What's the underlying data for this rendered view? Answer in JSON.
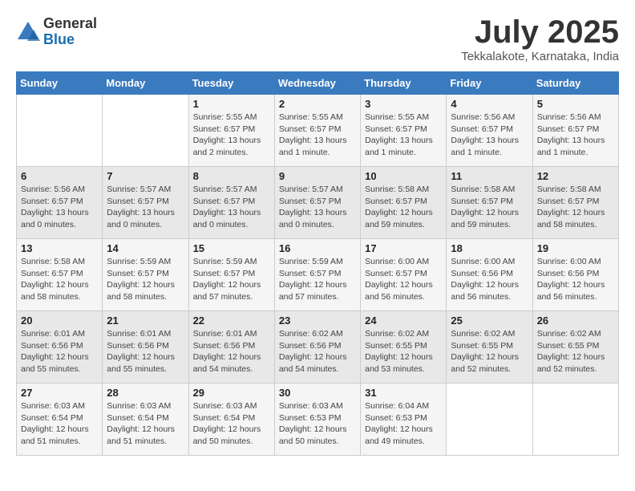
{
  "logo": {
    "line1": "General",
    "line2": "Blue"
  },
  "title": "July 2025",
  "location": "Tekkalakote, Karnataka, India",
  "days_of_week": [
    "Sunday",
    "Monday",
    "Tuesday",
    "Wednesday",
    "Thursday",
    "Friday",
    "Saturday"
  ],
  "weeks": [
    [
      {
        "day": "",
        "info": ""
      },
      {
        "day": "",
        "info": ""
      },
      {
        "day": "1",
        "info": "Sunrise: 5:55 AM\nSunset: 6:57 PM\nDaylight: 13 hours and 2 minutes."
      },
      {
        "day": "2",
        "info": "Sunrise: 5:55 AM\nSunset: 6:57 PM\nDaylight: 13 hours and 1 minute."
      },
      {
        "day": "3",
        "info": "Sunrise: 5:55 AM\nSunset: 6:57 PM\nDaylight: 13 hours and 1 minute."
      },
      {
        "day": "4",
        "info": "Sunrise: 5:56 AM\nSunset: 6:57 PM\nDaylight: 13 hours and 1 minute."
      },
      {
        "day": "5",
        "info": "Sunrise: 5:56 AM\nSunset: 6:57 PM\nDaylight: 13 hours and 1 minute."
      }
    ],
    [
      {
        "day": "6",
        "info": "Sunrise: 5:56 AM\nSunset: 6:57 PM\nDaylight: 13 hours and 0 minutes."
      },
      {
        "day": "7",
        "info": "Sunrise: 5:57 AM\nSunset: 6:57 PM\nDaylight: 13 hours and 0 minutes."
      },
      {
        "day": "8",
        "info": "Sunrise: 5:57 AM\nSunset: 6:57 PM\nDaylight: 13 hours and 0 minutes."
      },
      {
        "day": "9",
        "info": "Sunrise: 5:57 AM\nSunset: 6:57 PM\nDaylight: 13 hours and 0 minutes."
      },
      {
        "day": "10",
        "info": "Sunrise: 5:58 AM\nSunset: 6:57 PM\nDaylight: 12 hours and 59 minutes."
      },
      {
        "day": "11",
        "info": "Sunrise: 5:58 AM\nSunset: 6:57 PM\nDaylight: 12 hours and 59 minutes."
      },
      {
        "day": "12",
        "info": "Sunrise: 5:58 AM\nSunset: 6:57 PM\nDaylight: 12 hours and 58 minutes."
      }
    ],
    [
      {
        "day": "13",
        "info": "Sunrise: 5:58 AM\nSunset: 6:57 PM\nDaylight: 12 hours and 58 minutes."
      },
      {
        "day": "14",
        "info": "Sunrise: 5:59 AM\nSunset: 6:57 PM\nDaylight: 12 hours and 58 minutes."
      },
      {
        "day": "15",
        "info": "Sunrise: 5:59 AM\nSunset: 6:57 PM\nDaylight: 12 hours and 57 minutes."
      },
      {
        "day": "16",
        "info": "Sunrise: 5:59 AM\nSunset: 6:57 PM\nDaylight: 12 hours and 57 minutes."
      },
      {
        "day": "17",
        "info": "Sunrise: 6:00 AM\nSunset: 6:57 PM\nDaylight: 12 hours and 56 minutes."
      },
      {
        "day": "18",
        "info": "Sunrise: 6:00 AM\nSunset: 6:56 PM\nDaylight: 12 hours and 56 minutes."
      },
      {
        "day": "19",
        "info": "Sunrise: 6:00 AM\nSunset: 6:56 PM\nDaylight: 12 hours and 56 minutes."
      }
    ],
    [
      {
        "day": "20",
        "info": "Sunrise: 6:01 AM\nSunset: 6:56 PM\nDaylight: 12 hours and 55 minutes."
      },
      {
        "day": "21",
        "info": "Sunrise: 6:01 AM\nSunset: 6:56 PM\nDaylight: 12 hours and 55 minutes."
      },
      {
        "day": "22",
        "info": "Sunrise: 6:01 AM\nSunset: 6:56 PM\nDaylight: 12 hours and 54 minutes."
      },
      {
        "day": "23",
        "info": "Sunrise: 6:02 AM\nSunset: 6:56 PM\nDaylight: 12 hours and 54 minutes."
      },
      {
        "day": "24",
        "info": "Sunrise: 6:02 AM\nSunset: 6:55 PM\nDaylight: 12 hours and 53 minutes."
      },
      {
        "day": "25",
        "info": "Sunrise: 6:02 AM\nSunset: 6:55 PM\nDaylight: 12 hours and 52 minutes."
      },
      {
        "day": "26",
        "info": "Sunrise: 6:02 AM\nSunset: 6:55 PM\nDaylight: 12 hours and 52 minutes."
      }
    ],
    [
      {
        "day": "27",
        "info": "Sunrise: 6:03 AM\nSunset: 6:54 PM\nDaylight: 12 hours and 51 minutes."
      },
      {
        "day": "28",
        "info": "Sunrise: 6:03 AM\nSunset: 6:54 PM\nDaylight: 12 hours and 51 minutes."
      },
      {
        "day": "29",
        "info": "Sunrise: 6:03 AM\nSunset: 6:54 PM\nDaylight: 12 hours and 50 minutes."
      },
      {
        "day": "30",
        "info": "Sunrise: 6:03 AM\nSunset: 6:53 PM\nDaylight: 12 hours and 50 minutes."
      },
      {
        "day": "31",
        "info": "Sunrise: 6:04 AM\nSunset: 6:53 PM\nDaylight: 12 hours and 49 minutes."
      },
      {
        "day": "",
        "info": ""
      },
      {
        "day": "",
        "info": ""
      }
    ]
  ]
}
